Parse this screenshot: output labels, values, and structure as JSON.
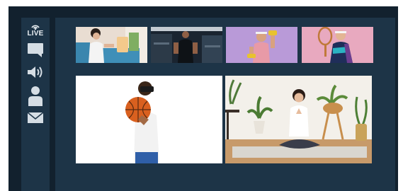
{
  "sidebar": {
    "live_label": "LIVE",
    "icons": [
      "live-broadcast-icon",
      "chat-icon",
      "volume-icon",
      "user-icon",
      "mail-icon"
    ],
    "icon_color": "#d5dde4"
  },
  "participants": {
    "thumbnails": [
      {
        "name": "woman-on-sofa-thumbnail"
      },
      {
        "name": "man-in-gym-thumbnail"
      },
      {
        "name": "man-with-dumbbell-thumbnail"
      },
      {
        "name": "man-with-tennis-racket-thumbnail"
      }
    ],
    "main_tiles": [
      {
        "name": "basketball-vr-tile"
      },
      {
        "name": "meditation-tile"
      }
    ]
  },
  "colors": {
    "frame": "#12212e",
    "panel": "#1d3447",
    "accent_purple": "#b99ad8",
    "accent_pink": "#e8a9bf"
  }
}
